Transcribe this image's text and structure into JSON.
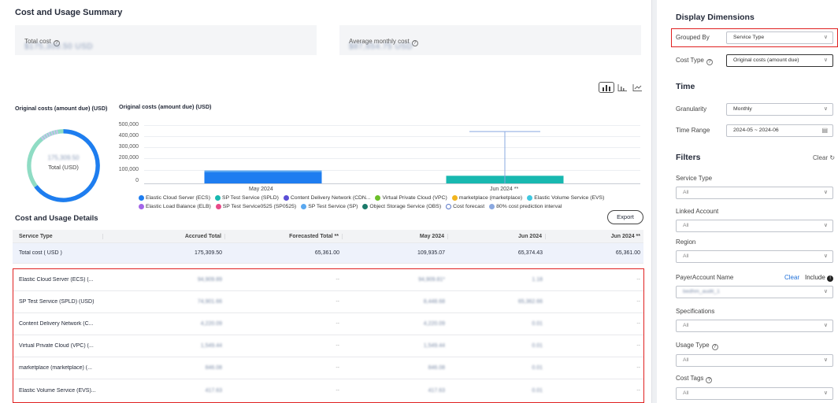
{
  "summary": {
    "title": "Cost and Usage Summary",
    "total_cost_label": "Total cost",
    "total_cost_value": "$175,309.50 USD",
    "avg_cost_label": "Average monthly cost",
    "avg_cost_value": "$87,654.75 USD"
  },
  "donut": {
    "title": "Original costs (amount due) (USD)",
    "center_value": "175,309.50",
    "center_label": "Total (USD)"
  },
  "chart_data": {
    "type": "bar",
    "title": "Original costs (amount due) (USD)",
    "categories": [
      "May 2024",
      "Jun 2024 **"
    ],
    "yticks": [
      "500,000",
      "400,000",
      "300,000",
      "200,000",
      "100,000",
      "0"
    ],
    "ylim": [
      0,
      500000
    ],
    "series": [
      {
        "name": "Elastic Cloud Server (ECS)",
        "values": [
          109935.07,
          65361.0
        ]
      }
    ],
    "error_band": {
      "category": "Jun 2024 **",
      "low": 0,
      "high": 445000
    },
    "colors": {
      "may_bar": "#1e7df0",
      "jun_bar": "#18b8b0",
      "band": "#8aa8e0"
    },
    "legend": [
      {
        "label": "Elastic Cloud Server (ECS)",
        "color": "#1e7df0"
      },
      {
        "label": "SP Test Service (SPLD)",
        "color": "#18b8b0"
      },
      {
        "label": "Content Delivery Network (CDN...",
        "color": "#5b4fd6"
      },
      {
        "label": "Virtual Private Cloud (VPC)",
        "color": "#6cbf2a"
      },
      {
        "label": "marketplace (marketplace)",
        "color": "#f2b51e"
      },
      {
        "label": "Elastic Volume Service (EVS)",
        "color": "#3fc8e0"
      },
      {
        "label": "Elastic Load Balance (ELB)",
        "color": "#a366e8"
      },
      {
        "label": "SP Test Service0525 (SP0525)",
        "color": "#e84a88"
      },
      {
        "label": "SP Test Service (SP)",
        "color": "#5aa8f0"
      },
      {
        "label": "Object Storage Service (OBS)",
        "color": "#1a7a6a"
      },
      {
        "label": "Cost forecast",
        "color": "#ffffff"
      },
      {
        "label": "80% cost prediction interval",
        "color": "#8aa8e0"
      }
    ]
  },
  "details": {
    "title": "Cost and Usage Details",
    "export_label": "Export",
    "headers": [
      "Service Type",
      "Accrued Total",
      "Forecasted Total **",
      "May 2024",
      "Jun 2024",
      "Jun 2024 **"
    ],
    "total_row": [
      "Total cost ( USD )",
      "175,309.50",
      "65,361.00",
      "109,935.07",
      "65,374.43",
      "65,361.00"
    ],
    "rows": [
      {
        "name": "Elastic Cloud Server (ECS) (...",
        "vals": [
          "94,909.89",
          "--",
          "94,909.81*",
          "1.18",
          "--"
        ]
      },
      {
        "name": "SP Test Service (SPLD) (USD)",
        "vals": [
          "74,901.66",
          "--",
          "8,448.68",
          "65,362.66",
          "--"
        ]
      },
      {
        "name": "Content Delivery Network (C...",
        "vals": [
          "4,220.09",
          "--",
          "4,220.09",
          "0.01",
          "--"
        ]
      },
      {
        "name": "Virtual Private Cloud (VPC) (...",
        "vals": [
          "1,549.44",
          "--",
          "1,549.44",
          "0.01",
          "--"
        ]
      },
      {
        "name": "marketplace (marketplace) (...",
        "vals": [
          "846.08",
          "--",
          "846.08",
          "0.01",
          "--"
        ]
      },
      {
        "name": "Elastic Volume Service (EVS)...",
        "vals": [
          "417.63",
          "--",
          "417.63",
          "0.01",
          "--"
        ]
      }
    ]
  },
  "panel": {
    "display_title": "Display Dimensions",
    "grouped_by_label": "Grouped By",
    "grouped_by_value": "Service Type",
    "cost_type_label": "Cost Type",
    "cost_type_value": "Original costs (amount due)",
    "time_title": "Time",
    "granularity_label": "Granularity",
    "granularity_value": "Monthly",
    "time_range_label": "Time Range",
    "time_range_value": "2024-05 ~ 2024-06",
    "filters_title": "Filters",
    "clear_label": "Clear",
    "service_type_label": "Service Type",
    "linked_account_label": "Linked Account",
    "region_label": "Region",
    "payer_label": "PayerAccount Name",
    "payer_clear": "Clear",
    "payer_include": "Include",
    "payer_value": "bedhm_audit_1",
    "specifications_label": "Specifications",
    "usage_type_label": "Usage Type",
    "cost_tags_label": "Cost Tags",
    "all_option": "All"
  }
}
